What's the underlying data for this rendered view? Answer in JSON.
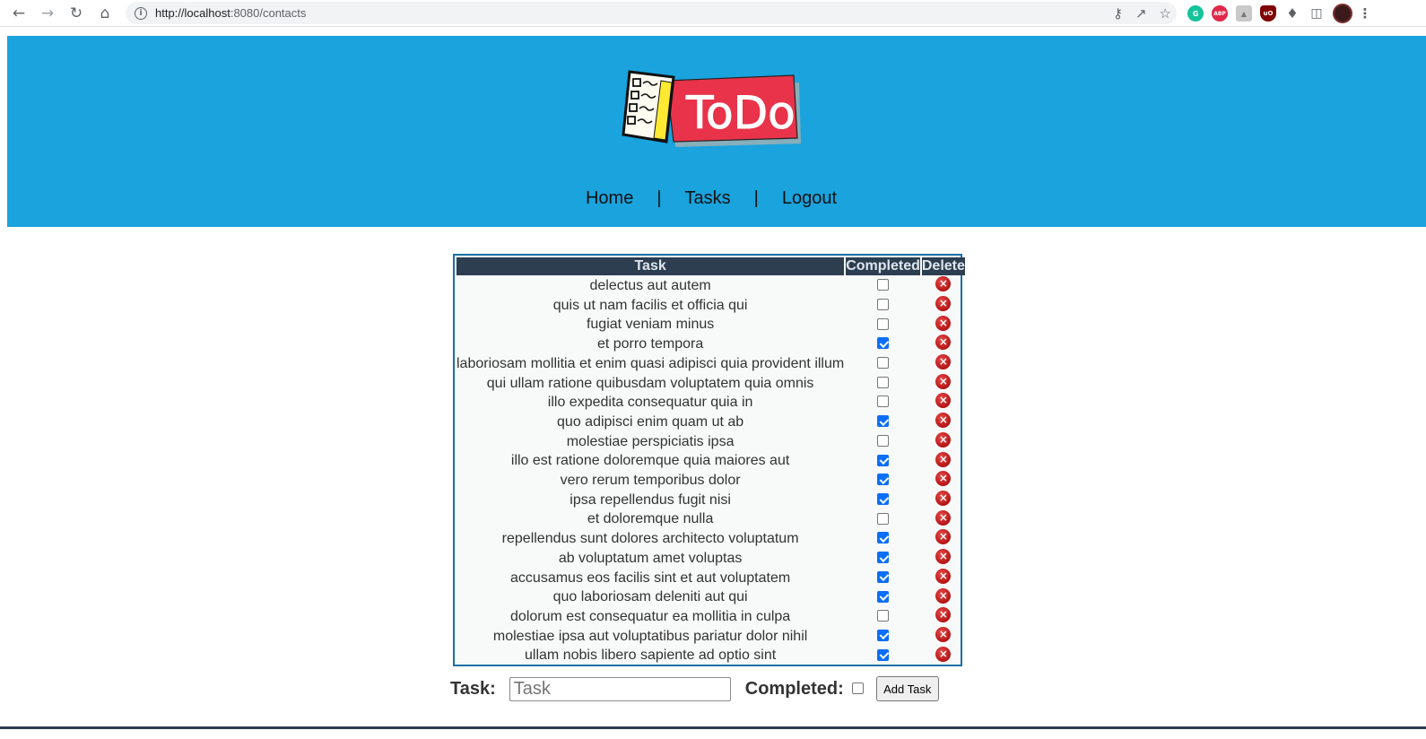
{
  "browser": {
    "url_host": "http://localhost",
    "url_rest": ":8080/contacts"
  },
  "nav": {
    "home": "Home",
    "sep1": "|",
    "tasks": "Tasks",
    "sep2": "|",
    "logout": "Logout"
  },
  "table": {
    "headers": {
      "task": "Task",
      "completed": "Completed",
      "delete": "Delete"
    },
    "rows": [
      {
        "task": "delectus aut autem",
        "completed": false
      },
      {
        "task": "quis ut nam facilis et officia qui",
        "completed": false
      },
      {
        "task": "fugiat veniam minus",
        "completed": false
      },
      {
        "task": "et porro tempora",
        "completed": true
      },
      {
        "task": "laboriosam mollitia et enim quasi adipisci quia provident illum",
        "completed": false
      },
      {
        "task": "qui ullam ratione quibusdam voluptatem quia omnis",
        "completed": false
      },
      {
        "task": "illo expedita consequatur quia in",
        "completed": false
      },
      {
        "task": "quo adipisci enim quam ut ab",
        "completed": true
      },
      {
        "task": "molestiae perspiciatis ipsa",
        "completed": false
      },
      {
        "task": "illo est ratione doloremque quia maiores aut",
        "completed": true
      },
      {
        "task": "vero rerum temporibus dolor",
        "completed": true
      },
      {
        "task": "ipsa repellendus fugit nisi",
        "completed": true
      },
      {
        "task": "et doloremque nulla",
        "completed": false
      },
      {
        "task": "repellendus sunt dolores architecto voluptatum",
        "completed": true
      },
      {
        "task": "ab voluptatum amet voluptas",
        "completed": true
      },
      {
        "task": "accusamus eos facilis sint et aut voluptatem",
        "completed": true
      },
      {
        "task": "quo laboriosam deleniti aut qui",
        "completed": true
      },
      {
        "task": "dolorum est consequatur ea mollitia in culpa",
        "completed": false
      },
      {
        "task": "molestiae ipsa aut voluptatibus pariatur dolor nihil",
        "completed": true
      },
      {
        "task": "ullam nobis libero sapiente ad optio sint",
        "completed": true
      }
    ]
  },
  "form": {
    "task_label": "Task:",
    "task_placeholder": "Task",
    "task_value": "",
    "completed_label": "Completed:",
    "completed_checked": false,
    "add_button": "Add Task"
  },
  "logo": {
    "text": "ToDo"
  },
  "colors": {
    "header_bg": "#1aa3dd",
    "table_header_bg": "#2c3e50",
    "table_border": "#1b6fa3",
    "checkbox_checked": "#0b6ef8",
    "delete_red": "#c41e1e",
    "logo_red": "#e8334a"
  },
  "icons": {
    "back": "arrow-left-icon",
    "forward": "arrow-right-icon",
    "reload": "reload-icon",
    "home": "home-icon",
    "info": "info-icon",
    "key": "key-icon",
    "share": "share-icon",
    "star": "star-icon",
    "delete": "delete-x-icon"
  }
}
